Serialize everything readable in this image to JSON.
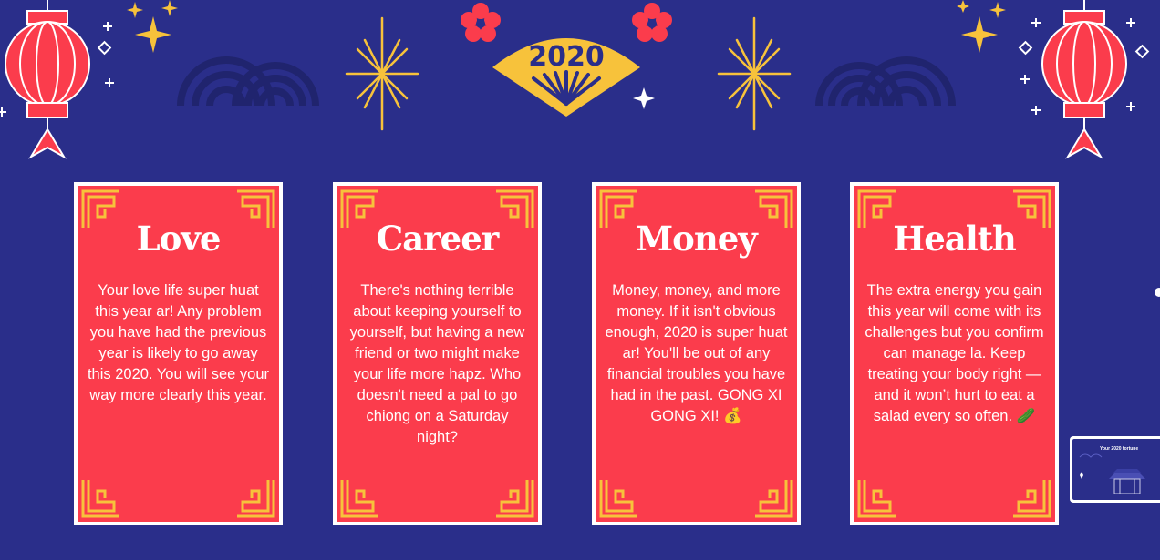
{
  "banner": {
    "year_fan_text": "2020"
  },
  "cards": [
    {
      "title": "Love",
      "body": "Your love life super huat this year ar! Any problem you have had the previous year is likely to go away this 2020. You will see your way more clearly this year."
    },
    {
      "title": "Career",
      "body": "There's nothing terrible about keeping yourself to yourself, but having a new friend or two might make your life more hapz. Who doesn't need a pal to go chiong on a Saturday night?"
    },
    {
      "title": "Money",
      "body": "Money, money, and more money. If it isn't obvious enough, 2020 is super huat ar! You'll be out of any financial troubles you have had in the past. GONG XI GONG XI! 💰"
    },
    {
      "title": "Health",
      "body": "The extra energy you gain this year will come with its challenges but you confirm can manage la. Keep treating your body right — and it won’t hurt to eat a salad every so often. 🥒"
    }
  ],
  "thumbnail": {
    "title": "Your 2020 fortune"
  },
  "colors": {
    "background": "#2a2e8a",
    "card_red": "#fb3c4c",
    "gold": "#f7c23b",
    "lantern_red": "#fb3c4c"
  }
}
